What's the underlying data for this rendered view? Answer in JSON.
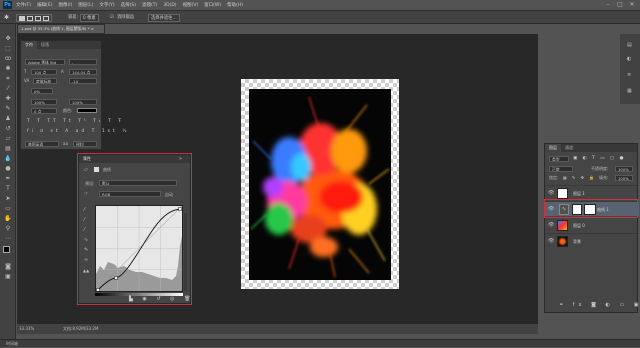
{
  "app": {
    "logo": "Ps"
  },
  "menu": [
    "文件(F)",
    "编辑(E)",
    "图像(I)",
    "图层(L)",
    "文字(Y)",
    "选择(S)",
    "滤镜(T)",
    "3D(D)",
    "视图(V)",
    "窗口(W)",
    "帮助(H)"
  ],
  "window_controls": [
    "–",
    "□",
    "✕"
  ],
  "options": {
    "tolerance_label": "容差:",
    "tolerance_value": "0 像素",
    "antialias_label": "消除锯齿",
    "select_mask": "选择并遮住..."
  },
  "document_tab": "1.psd @ 33.3% (曲线 1, 图层蒙版/8) * ×",
  "character_panel": {
    "tabs": [
      "字符",
      "段落"
    ],
    "font_family": "Adobe 黑体 Std",
    "font_style": "-",
    "font_size": "100 点",
    "leading": "144.04 点",
    "tracking_label": "VA",
    "kerning": "度量标准",
    "tracking_value": "-14",
    "vertical_scale": "0%",
    "horizontal_scale": "100%",
    "baseline": "0 点",
    "color_label": "颜色:",
    "scale2": "100%",
    "aa": "锐利",
    "lang": "美国英语",
    "aa_value": "aa"
  },
  "properties_panel": {
    "title": "属性",
    "subtitle": "曲线",
    "preset_label": "预设:",
    "preset_value": "默认",
    "channel_value": "RGB",
    "auto_label": "自动"
  },
  "layers_panel": {
    "tabs": [
      "图层",
      "通道"
    ],
    "kind": "类型",
    "blend": "正常",
    "opacity_label": "不透明度:",
    "opacity": "100%",
    "lock_label": "锁定:",
    "fill_label": "填充:",
    "fill": "100%",
    "layers": [
      {
        "name": "图层 1"
      },
      {
        "name": "曲线 1"
      },
      {
        "name": "图层 0"
      },
      {
        "name": "背景"
      }
    ]
  },
  "status": {
    "zoom": "33.33%",
    "doc_size": "文档:8.92M/33.2M"
  },
  "timeline": "时间轴",
  "colors": {
    "highlight": "#d0303a",
    "workspace": "#282828"
  }
}
